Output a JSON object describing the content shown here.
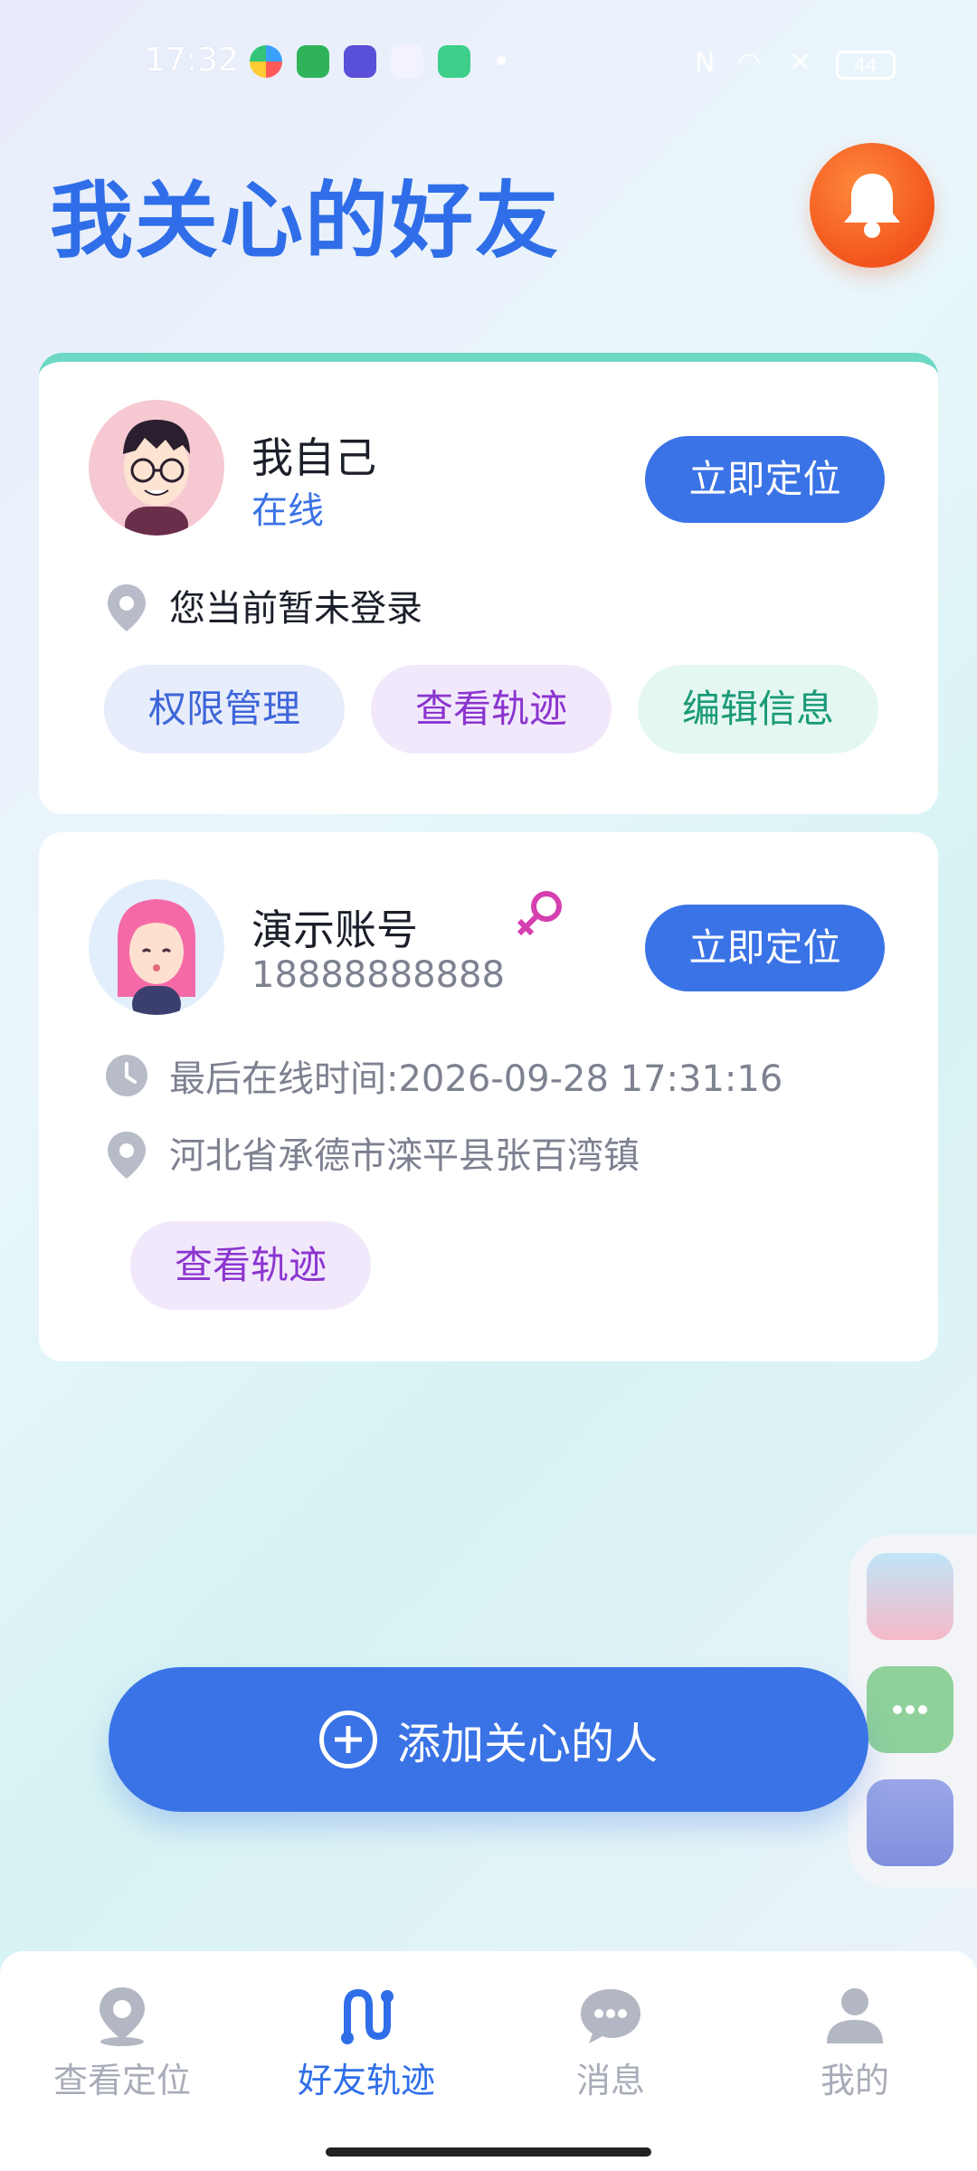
{
  "status_bar": {
    "time": "17:32",
    "battery": "44"
  },
  "header": {
    "title": "我关心的好友"
  },
  "self_card": {
    "name": "我自己",
    "status": "在线",
    "locate_label": "立即定位",
    "location_text": "您当前暂未登录",
    "actions": [
      "权限管理",
      "查看轨迹",
      "编辑信息"
    ]
  },
  "friend_card": {
    "name": "演示账号",
    "phone": "18888888888",
    "locate_label": "立即定位",
    "last_online": "最后在线时间:2026-09-28 17:31:16",
    "address": "河北省承德市滦平县张百湾镇",
    "track_label": "查看轨迹"
  },
  "add_button": {
    "label": "添加关心的人"
  },
  "tabs": [
    {
      "label": "查看定位",
      "icon": "location-pin-icon"
    },
    {
      "label": "好友轨迹",
      "icon": "route-icon"
    },
    {
      "label": "消息",
      "icon": "chat-bubble-icon"
    },
    {
      "label": "我的",
      "icon": "person-icon"
    }
  ],
  "colors": {
    "accent": "#3a73e6",
    "title": "#2f6ee8",
    "bell": "#f2551c"
  }
}
